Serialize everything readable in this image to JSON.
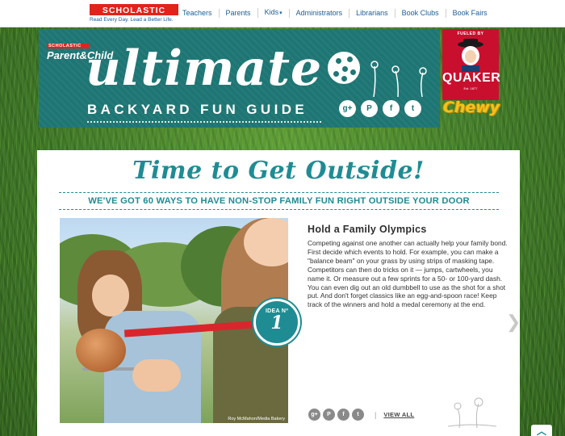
{
  "brand": {
    "name": "SCHOLASTIC",
    "tagline": "Read Every Day. Lead a Better Life."
  },
  "nav": {
    "items": [
      {
        "label": "Teachers"
      },
      {
        "label": "Parents"
      },
      {
        "label": "Kids",
        "has_dropdown": true
      },
      {
        "label": "Administrators"
      },
      {
        "label": "Librarians"
      },
      {
        "label": "Book Clubs"
      },
      {
        "label": "Book Fairs"
      }
    ]
  },
  "hero": {
    "publisher_tag": "SCHOLASTIC",
    "publication": "Parent&Child",
    "title": "ultimate",
    "subtitle": "BACKYARD FUN GUIDE",
    "social": [
      {
        "icon": "google-plus-icon",
        "glyph": "g+"
      },
      {
        "icon": "pinterest-icon",
        "glyph": "P"
      },
      {
        "icon": "facebook-icon",
        "glyph": "f"
      },
      {
        "icon": "twitter-icon",
        "glyph": "t"
      }
    ]
  },
  "sponsor": {
    "fueled_by": "FUELED BY",
    "brand": "QUAKER",
    "est": "Est. 1877",
    "product": "Chewy"
  },
  "main": {
    "headline": "Time to Get Outside!",
    "subheadline": "WE'VE GOT 60 WAYS TO HAVE NON-STOP FAMILY FUN RIGHT OUTSIDE YOUR DOOR",
    "photo_credit": "Roy McMahon/Media Bakery",
    "idea_label": "IDEA Nº",
    "idea_number": "1",
    "article_title": "Hold a Family Olympics",
    "article_body": "Competing against one another can actually help your family bond. First decide which events to hold. For example, you can make a \"balance beam\" on your grass by using strips of masking tape. Competitors can then do tricks on it — jumps, cartwheels, you name it. Or measure out a few sprints for a 50- or 100-yard dash. You can even dig out an old dumbbell to use as the shot for a shot put. And don't forget classics like an egg-and-spoon race! Keep track of the winners and hold a medal ceremony at the end.",
    "share": [
      {
        "icon": "google-plus-icon",
        "glyph": "g+"
      },
      {
        "icon": "pinterest-icon",
        "glyph": "P"
      },
      {
        "icon": "facebook-icon",
        "glyph": "f"
      },
      {
        "icon": "twitter-icon",
        "glyph": "t"
      }
    ],
    "view_all": "VIEW ALL"
  },
  "colors": {
    "teal": "#1f8c93",
    "banner_teal": "#1e7674",
    "scholastic_red": "#e2231a",
    "quaker_red": "#c8102e",
    "chewy_yellow": "#f2c21a"
  }
}
